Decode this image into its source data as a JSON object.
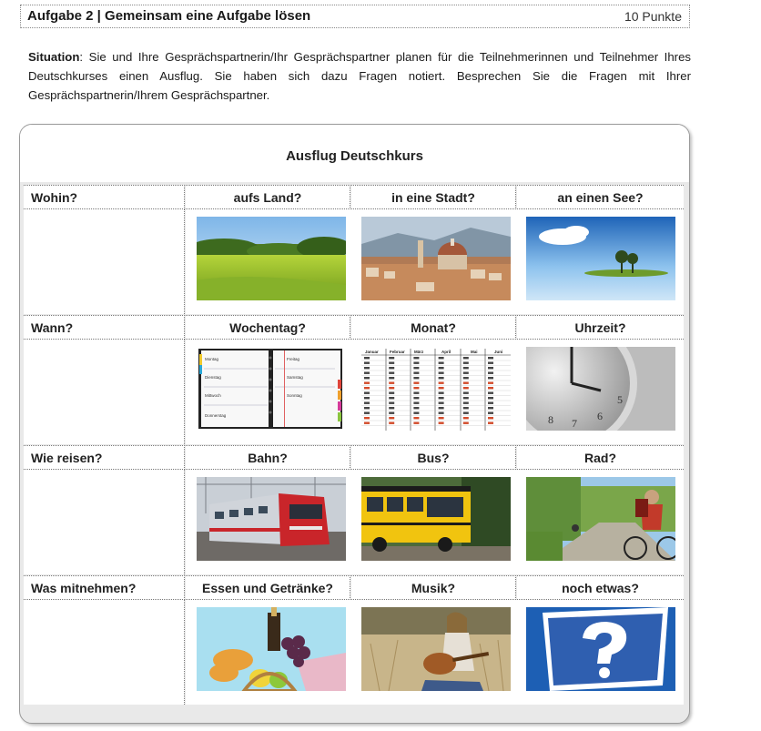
{
  "header": {
    "title": "Aufgabe 2 | Gemeinsam eine Aufgabe lösen",
    "points": "10 Punkte"
  },
  "situation": {
    "label": "Situation",
    "text": ": Sie und Ihre Gesprächspartnerin/Ihr Gesprächspartner planen für die Teilnehmerinnen und Teilnehmer Ihres Deutschkurses einen Ausflug. Sie haben sich dazu Fragen notiert. Besprechen Sie die Fragen mit Ihrer Gesprächspartnerin/Ihrem Gesprächspartner."
  },
  "panel": {
    "title": "Ausflug Deutschkurs",
    "rows": [
      {
        "label": "Wohin?",
        "options": [
          "aufs Land?",
          "in eine Stadt?",
          "an einen See?"
        ],
        "images": [
          "countryside-photo",
          "city-photo",
          "lake-photo"
        ]
      },
      {
        "label": "Wann?",
        "options": [
          "Wochentag?",
          "Monat?",
          "Uhrzeit?"
        ],
        "images": [
          "weekly-planner-photo",
          "monthly-calendar-photo",
          "clock-photo"
        ]
      },
      {
        "label": "Wie reisen?",
        "options": [
          "Bahn?",
          "Bus?",
          "Rad?"
        ],
        "images": [
          "train-photo",
          "school-bus-photo",
          "cyclist-photo"
        ]
      },
      {
        "label": "Was mitnehmen?",
        "options": [
          "Essen und Getränke?",
          "Musik?",
          "noch etwas?"
        ],
        "images": [
          "picnic-basket-photo",
          "guitar-player-photo",
          "question-sign-photo"
        ]
      }
    ]
  },
  "planner": {
    "days_left": [
      "Montag",
      "Dienstag",
      "Mittwoch",
      "Donnerstag"
    ],
    "days_right": [
      "Freitag",
      "Samstag",
      "Sonntag"
    ]
  },
  "calendar": {
    "months": [
      "Januar",
      "Februar",
      "März",
      "April",
      "Mai",
      "Juni"
    ]
  },
  "clock": {
    "numerals": [
      "8",
      "7",
      "6",
      "5"
    ]
  },
  "colors": {
    "panel_bg": "#e9e9e9",
    "border": "#9a9a9a",
    "sign_blue": "#2f5fb0"
  }
}
